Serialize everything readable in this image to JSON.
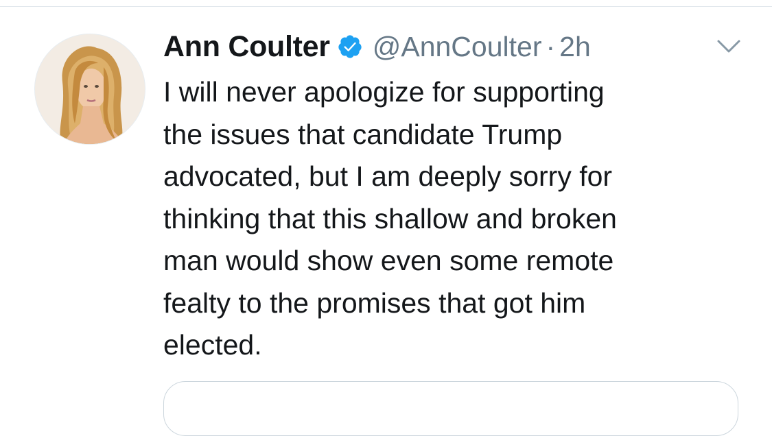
{
  "tweet": {
    "author": {
      "display_name": "Ann Coulter",
      "handle": "@AnnCoulter",
      "verified": true,
      "verified_icon": "verified-badge-icon",
      "avatar_icon": "profile-avatar"
    },
    "separator": "·",
    "timestamp": "2h",
    "menu_icon": "chevron-down-icon",
    "text": "I will never apologize for supporting\nthe issues that candidate Trump\nadvocated, but I am deeply sorry for\nthinking that this shallow and broken\nman would show even some remote\nfealty to the promises that got him\nelected."
  },
  "colors": {
    "text_primary": "#14171a",
    "text_secondary": "#657786",
    "verified_blue": "#1da1f2",
    "divider": "#e1e8ed"
  }
}
